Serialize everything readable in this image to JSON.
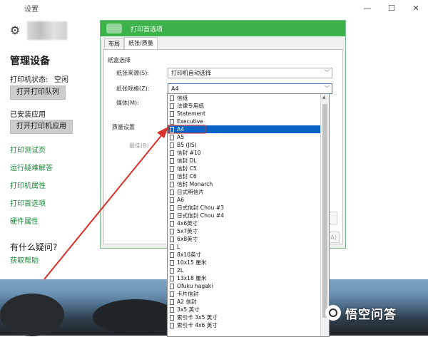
{
  "window": {
    "title": "设置",
    "minimize_glyph": "—",
    "maximize_glyph": "☐",
    "close_glyph": "✕"
  },
  "header": {
    "gear_icon": "gear-icon"
  },
  "page": {
    "title": "管理设备",
    "status_label": "打印机状态:",
    "status_value": "空闲",
    "queue_button": "打开打印队列",
    "installed_label": "已安装应用",
    "open_printer_button": "打开打印机应用",
    "links": [
      "打印测试页",
      "运行疑难解答",
      "打印机属性",
      "打印首选项",
      "硬件属性"
    ],
    "question": "有什么疑问?",
    "help_link": "获取帮助"
  },
  "dialog": {
    "title": "打印首选项",
    "tabs": [
      "布局",
      "纸张/质量"
    ],
    "active_tab": "纸张/质量",
    "tray_section": "纸盒选择",
    "source_label": "纸张来源(S):",
    "source_value": "打印机自动选择",
    "size_label": "纸张规格(Z):",
    "size_value": "A4",
    "media_label": "媒体(M):",
    "quality_section": "质量设置",
    "color_option": "最佳(B)"
  },
  "paper_list": {
    "selected": "A4",
    "items": [
      "信纸",
      "法律专用纸",
      "Statement",
      "Executive",
      "A4",
      "A5",
      "B5 (JIS)",
      "信封 #10",
      "信封 DL",
      "信封 C5",
      "信封 C6",
      "信封 Monarch",
      "日式明信片",
      "A6",
      "日式信封 Chou #3",
      "日式信封 Chou #4",
      "4x6英寸",
      "5x7英寸",
      "6x8英寸",
      "L",
      "8x10英寸",
      "10x15 厘米",
      "2L",
      "13x18 厘米",
      "Ofuku hagaki",
      "卡片信封",
      "A2 信封",
      "3x5 英寸",
      "索引卡 3x5 英寸",
      "索引卡 4x6 英寸"
    ]
  },
  "watermark": {
    "text": "悟空问答"
  },
  "colors": {
    "accent_green": "#3cb24a",
    "link_green": "#1e8a3c",
    "selection_blue": "#0a64c8",
    "arrow_red": "#d8322a"
  }
}
